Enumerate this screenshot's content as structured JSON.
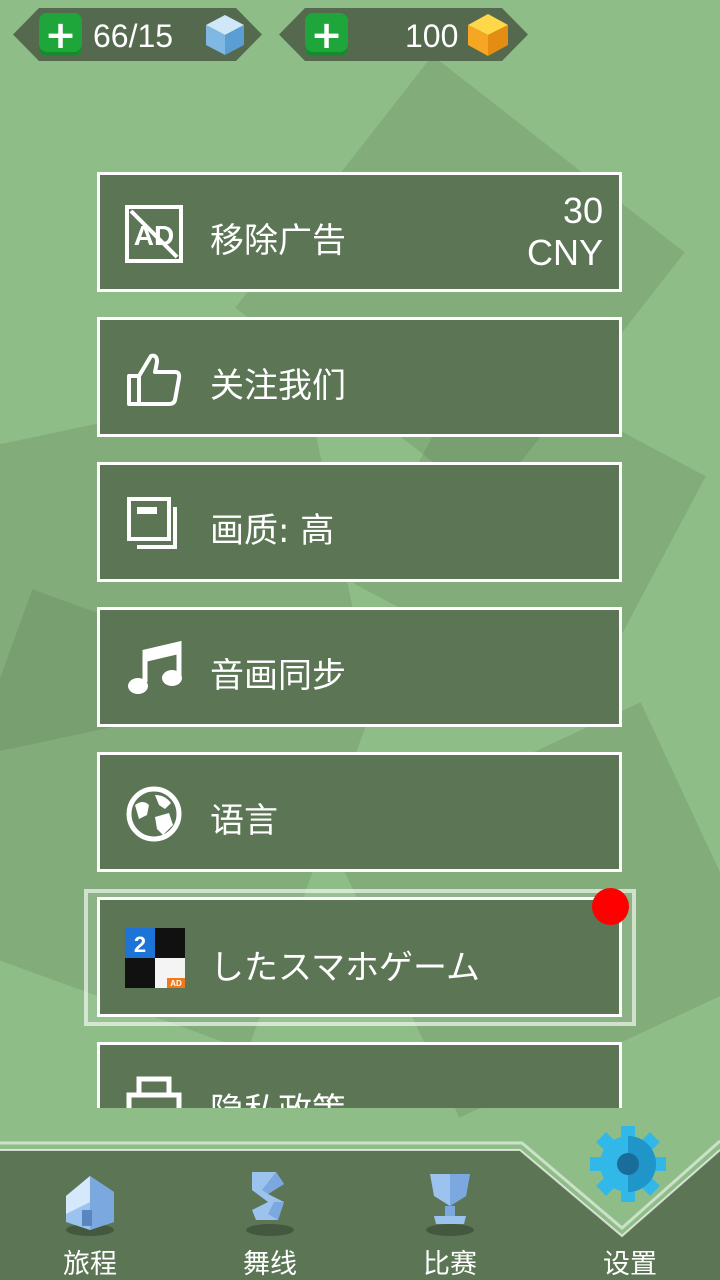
{
  "currency": {
    "energy_value": "66/15",
    "energy_plus_label": "+",
    "gems_value": "100",
    "gems_plus_label": "+"
  },
  "menu": {
    "items": [
      {
        "label": "移除广告",
        "icon": "no-ads-icon",
        "price_amount": "30",
        "price_currency": "CNY"
      },
      {
        "label": "关注我们",
        "icon": "thumbs-up-icon"
      },
      {
        "label": "画质: 高",
        "icon": "picture-quality-icon"
      },
      {
        "label": "音画同步",
        "icon": "music-note-icon"
      },
      {
        "label": "语言",
        "icon": "globe-icon"
      },
      {
        "label": "したスマホゲーム",
        "icon": "piano-tiles-2-ad-icon",
        "badge": "AD",
        "app_number": "2"
      },
      {
        "label": "隐私政策",
        "icon": "printer-icon"
      }
    ]
  },
  "bottom_nav": {
    "items": [
      {
        "label": "旅程",
        "icon": "house-icon"
      },
      {
        "label": "舞线",
        "icon": "dancing-line-icon"
      },
      {
        "label": "比赛",
        "icon": "trophy-icon"
      },
      {
        "label": "设置",
        "icon": "gear-icon",
        "active": true
      }
    ]
  },
  "colors": {
    "background": "#8fbd88",
    "panel": "#5b7555",
    "plus_green": "#1fa63a",
    "gear_blue": "#31b7e8",
    "notification_red": "#ff0000"
  }
}
